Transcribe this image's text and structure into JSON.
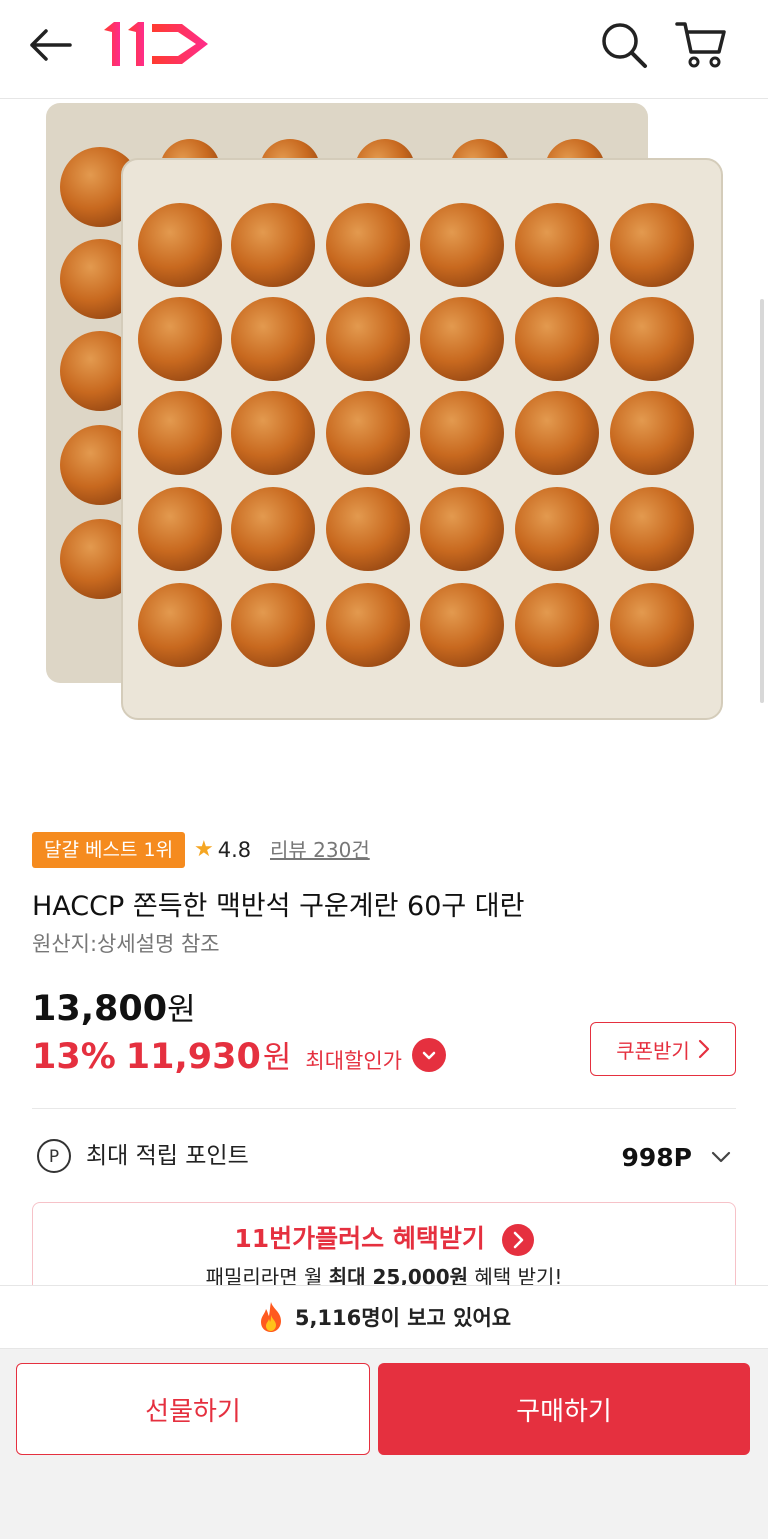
{
  "header": {
    "logo_text": "11번가 로고"
  },
  "product": {
    "badge": "달걀 베스트 1위",
    "rating": "4.8",
    "reviews": "리뷰 230건",
    "title": "HACCP 쫀득한 맥반석 구운계란 60구 대란",
    "origin": "원산지:상세설명 참조",
    "original_price": "13,800",
    "currency": "원",
    "discount_rate": "13%",
    "sale_price": "11,930",
    "max_discount_label": "최대할인가",
    "coupon_label": "쿠폰받기"
  },
  "points": {
    "label": "최대 적립 포인트",
    "value": "998P"
  },
  "plus_banner": {
    "brand": "11번가플러스",
    "title_suffix": " 혜택받기",
    "sub_prefix": "패밀리라면 월 ",
    "sub_bold": "최대 25,000원",
    "sub_suffix": " 혜택 받기!"
  },
  "viewers": {
    "text": "5,116명이 보고 있어요"
  },
  "actions": {
    "gift": "선물하기",
    "buy": "구매하기"
  },
  "colors": {
    "accent": "#e5303f",
    "badge": "#f58b1f",
    "egg": "#c86a22",
    "tray": "#e9e3d6"
  },
  "icons": [
    "back-arrow-icon",
    "search-icon",
    "cart-icon",
    "point-icon",
    "chevron-down-icon",
    "fire-icon"
  ]
}
